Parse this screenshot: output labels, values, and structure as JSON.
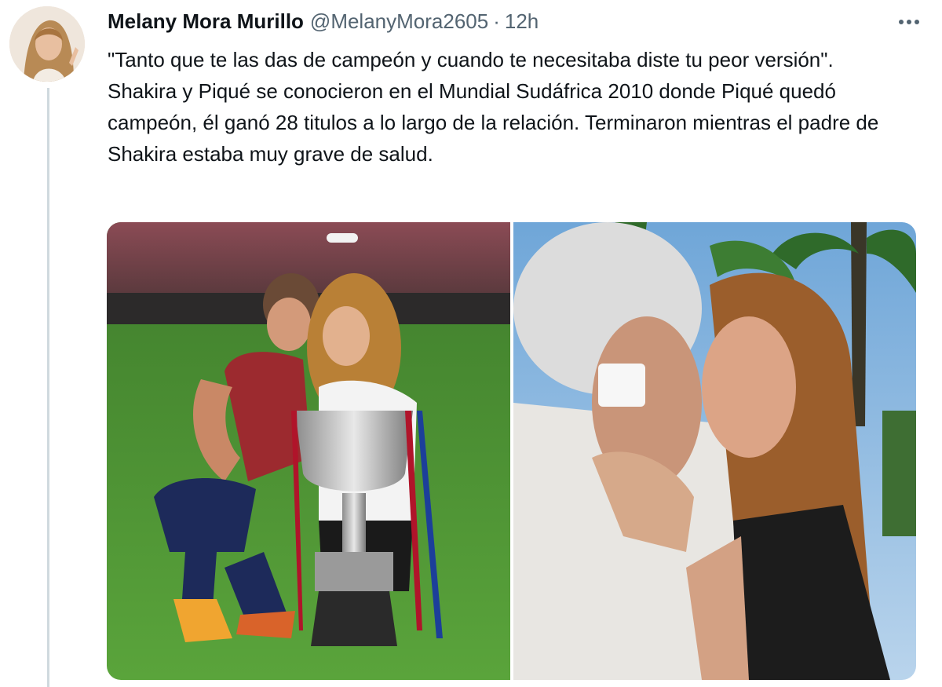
{
  "tweet": {
    "author_name": "Melany Mora Murillo",
    "handle": "@MelanyMora2605",
    "separator": "·",
    "time": "12h",
    "more_icon": "more-horizontal-icon",
    "lines": [
      "\"Tanto que te las das de campeón y cuando te necesitaba diste tu peor versión\".",
      "Shakira y Piqué se conocieron en el Mundial Sudáfrica 2010 donde Piqué quedó campeón, él ganó 28 titulos a lo largo de la relación. Terminaron mientras el padre de Shakira estaba muy grave de salud."
    ]
  },
  "colors": {
    "text": "#0f1419",
    "secondary": "#536471",
    "thread_line": "#cfd9de"
  }
}
